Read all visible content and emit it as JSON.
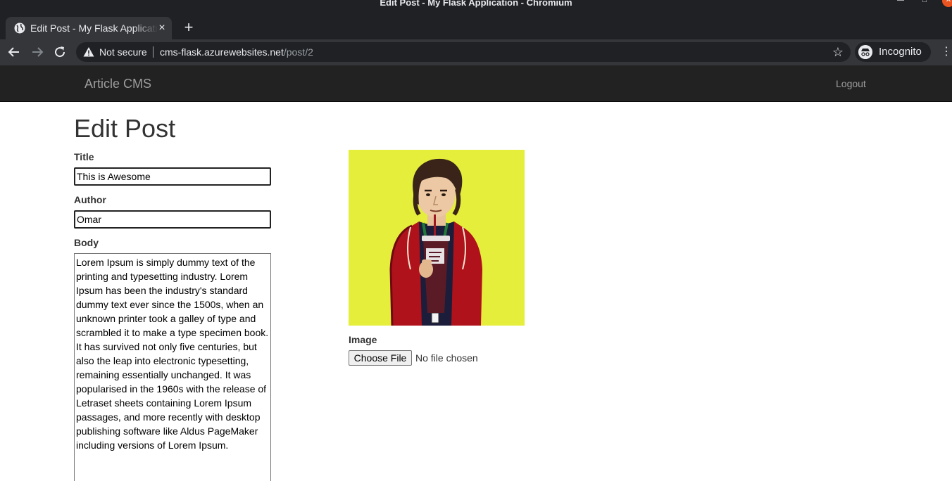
{
  "window": {
    "title": "Edit Post - My Flask Application - Chromium"
  },
  "browser": {
    "tab_title": "Edit Post - My Flask Application",
    "security_label": "Not secure",
    "url_host": "cms-flask.azurewebsites.net",
    "url_path": "/post/2",
    "incognito_label": "Incognito"
  },
  "navbar": {
    "brand": "Article CMS",
    "logout": "Logout"
  },
  "page": {
    "heading": "Edit Post"
  },
  "form": {
    "title_label": "Title",
    "title_value": "This is Awesome",
    "author_label": "Author",
    "author_value": "Omar",
    "body_label": "Body",
    "body_value": "Lorem Ipsum is simply dummy text of the printing and typesetting industry. Lorem Ipsum has been the industry's standard dummy text ever since the 1500s, when an unknown printer took a galley of type and scrambled it to make a type specimen book. It has survived not only five centuries, but also the leap into electronic typesetting, remaining essentially unchanged. It was popularised in the 1960s with the release of Letraset sheets containing Lorem Ipsum passages, and more recently with desktop publishing software like Aldus PageMaker including versions of Lorem Ipsum.",
    "image_label": "Image",
    "file_button": "Choose File",
    "file_status": "No file chosen"
  },
  "colors": {
    "navbar_bg": "#222222",
    "image_bg": "#e5ee3b",
    "chrome_dark": "#202124",
    "chrome_tab": "#35363a"
  },
  "icons": {
    "tab_favicon": "globe-icon",
    "security": "warning-icon",
    "bookmark": "star-icon",
    "profile": "incognito-icon"
  }
}
